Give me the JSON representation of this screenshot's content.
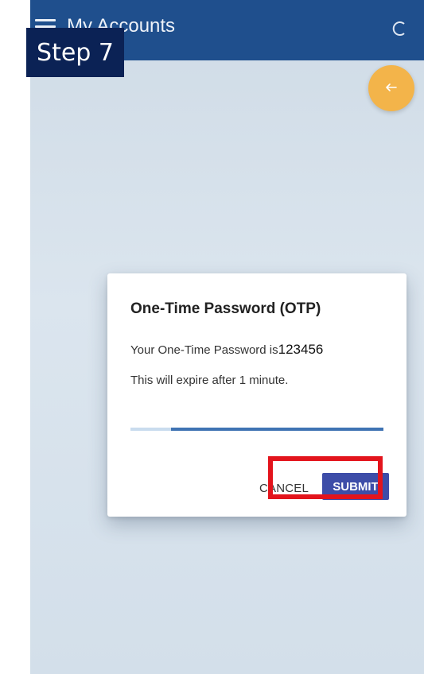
{
  "app_bar": {
    "title": "My Accounts",
    "menu_icon": "hamburger-menu-icon",
    "refresh_icon": "loading-spinner-icon",
    "background_color": "#1f4f8d"
  },
  "step_badge": {
    "label": "Step 7"
  },
  "back_button": {
    "icon": "arrow-left-icon",
    "color": "#f3b44a"
  },
  "dialog": {
    "title": "One-Time Password (OTP)",
    "message_prefix": "Your One-Time Password is",
    "otp_code": "123456",
    "expiry_text": "This will expire after 1 minute.",
    "remaining_fraction": 0.84,
    "cancel_label": "CANCEL",
    "submit_label": "SUBMIT",
    "submit_color": "#3d4da8"
  },
  "annotation": {
    "highlight_target": "submit-button",
    "color": "#e3141c"
  }
}
